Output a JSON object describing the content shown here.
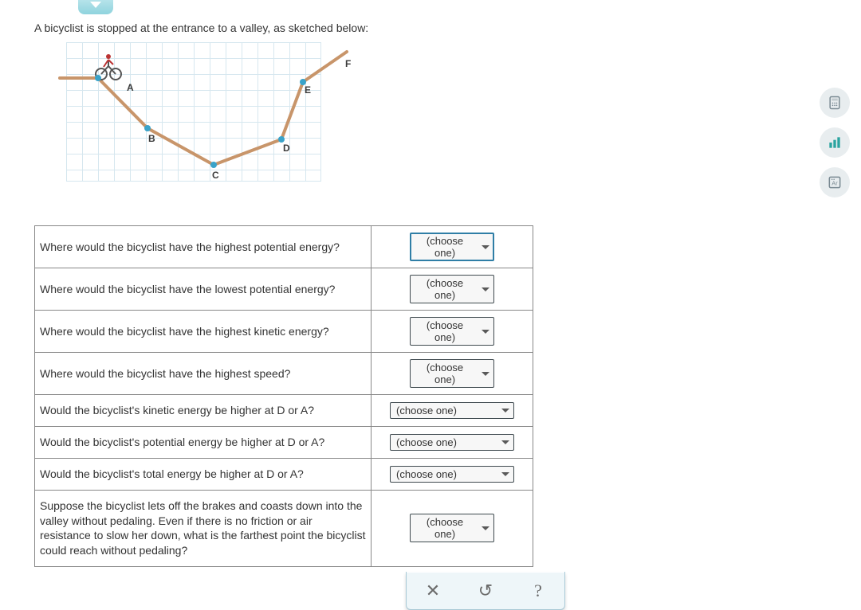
{
  "prompt": "A bicyclist is stopped at the entrance to a valley, as sketched below:",
  "diagram_labels": {
    "A": "A",
    "B": "B",
    "C": "C",
    "D": "D",
    "E": "E",
    "F": "F"
  },
  "select_placeholder": "(choose one)",
  "questions": [
    {
      "text": "Where would the bicyclist have the highest potential energy?",
      "size": "narrow",
      "active": true
    },
    {
      "text": "Where would the bicyclist have the lowest potential energy?",
      "size": "narrow",
      "active": false
    },
    {
      "text": "Where would the bicyclist have the highest kinetic energy?",
      "size": "narrow",
      "active": false
    },
    {
      "text": "Where would the bicyclist have the highest speed?",
      "size": "narrow",
      "active": false
    },
    {
      "text": "Would the bicyclist's kinetic energy be higher at D or A?",
      "size": "wide",
      "active": false
    },
    {
      "text": "Would the bicyclist's potential energy be higher at D or A?",
      "size": "wide",
      "active": false
    },
    {
      "text": "Would the bicyclist's total energy be higher at D or A?",
      "size": "wide",
      "active": false
    },
    {
      "text": "Suppose the bicyclist lets off the brakes and coasts down into the valley without pedaling. Even if there is no friction or air resistance to slow her down, what is the farthest point the bicyclist could reach without pedaling?",
      "size": "narrow",
      "active": false
    }
  ],
  "controls": {
    "clear": "✕",
    "undo": "↺",
    "help": "?"
  },
  "tools": {
    "calc": "calculator",
    "table": "periodic-table",
    "ar": "ar-tool"
  }
}
